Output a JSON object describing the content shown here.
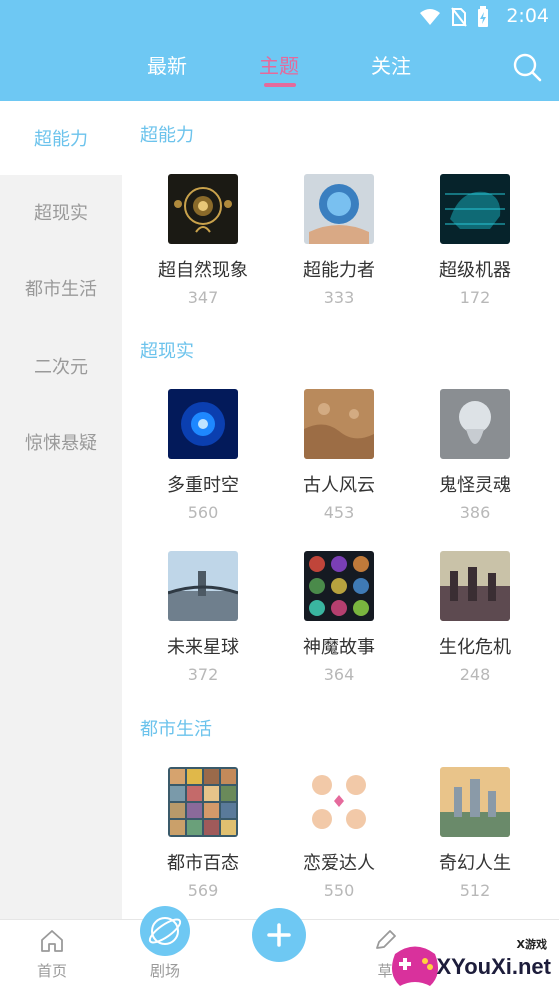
{
  "status_bar": {
    "time": "2:04"
  },
  "header": {
    "tabs": [
      {
        "label": "最新"
      },
      {
        "label": "主题"
      },
      {
        "label": "关注"
      }
    ],
    "active_tab": "主题"
  },
  "sidebar": {
    "items": [
      {
        "label": "超能力"
      },
      {
        "label": "超现实"
      },
      {
        "label": "都市生活"
      },
      {
        "label": "二次元"
      },
      {
        "label": "惊悚悬疑"
      }
    ],
    "active": "超能力"
  },
  "sections": [
    {
      "title": "超能力",
      "cards": [
        {
          "name": "超自然现象",
          "count": "347"
        },
        {
          "name": "超能力者",
          "count": "333"
        },
        {
          "name": "超级机器",
          "count": "172"
        }
      ]
    },
    {
      "title": "超现实",
      "cards": [
        {
          "name": "多重时空",
          "count": "560"
        },
        {
          "name": "古人风云",
          "count": "453"
        },
        {
          "name": "鬼怪灵魂",
          "count": "386"
        },
        {
          "name": "未来星球",
          "count": "372"
        },
        {
          "name": "神魔故事",
          "count": "364"
        },
        {
          "name": "生化危机",
          "count": "248"
        }
      ]
    },
    {
      "title": "都市生活",
      "cards": [
        {
          "name": "都市百态",
          "count": "569"
        },
        {
          "name": "恋爱达人",
          "count": "550"
        },
        {
          "name": "奇幻人生",
          "count": "512"
        }
      ]
    }
  ],
  "bottom_nav": {
    "items": [
      {
        "label": "首页"
      },
      {
        "label": "剧场"
      },
      {
        "label": "草"
      }
    ]
  },
  "watermark": {
    "small": "X游戏",
    "big": "XYouXi.net"
  },
  "colors": {
    "header_bg": "#6ec8f3",
    "accent_pink": "#e56a9c",
    "accent_blue": "#6cc3ec",
    "sidebar_bg": "#f2f2f2"
  }
}
